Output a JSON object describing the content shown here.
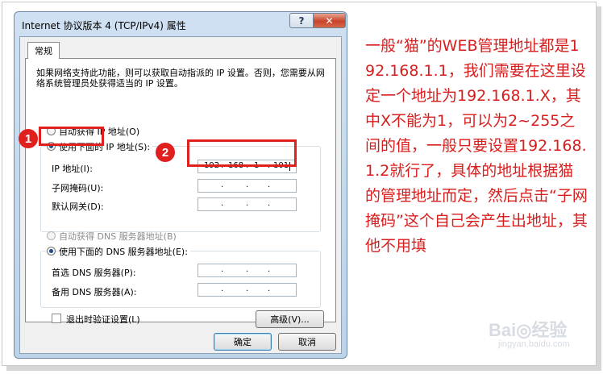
{
  "window": {
    "title": "Internet 协议版本 4 (TCP/IPv4) 属性",
    "help_label": "?",
    "close_label": "✕"
  },
  "tabs": [
    {
      "label": "常规",
      "selected": true
    }
  ],
  "general": {
    "intro": "如果网络支持此功能，则可以获取自动指派的 IP 设置。否则，您需要从网络系统管理员处获得适当的 IP 设置。",
    "auto_ip_label": "自动获得 IP 地址(O)",
    "manual_ip_label": "使用下面的 IP 地址(S):",
    "ip_label": "IP 地址(I):",
    "ip_value": [
      "192",
      "168",
      "1",
      "101"
    ],
    "subnet_label": "子网掩码(U):",
    "gateway_label": "默认网关(D):",
    "auto_dns_label": "自动获得 DNS 服务器地址(B)",
    "manual_dns_label": "使用下面的 DNS 服务器地址(E):",
    "preferred_dns_label": "首选 DNS 服务器(P):",
    "alternate_dns_label": "备用 DNS 服务器(A):",
    "validate_label": "退出时验证设置(L)",
    "advanced_label": "高级(V)...",
    "selected_ip_mode": "manual",
    "selected_dns_mode": "manual",
    "validate_checked": false
  },
  "footer": {
    "ok_label": "确定",
    "cancel_label": "取消"
  },
  "annotations": {
    "marker_1": "1",
    "marker_2": "2",
    "note": "一般“猫”的WEB管理地址都是192.168.1.1，我们需要在这里设定一个地址为192.168.1.X，其中X不能为1，可以为2~255之间的值，一般只要设置192.168.1.2就行了，具体的地址根据猫的管理地址而定，然后点击“子网掩码”这个自己会产生出地址，其他不用填",
    "accent_color": "#e01f1f"
  },
  "watermark": {
    "text": "Bai◎经验",
    "sub": "jingyan.baidu.com"
  }
}
